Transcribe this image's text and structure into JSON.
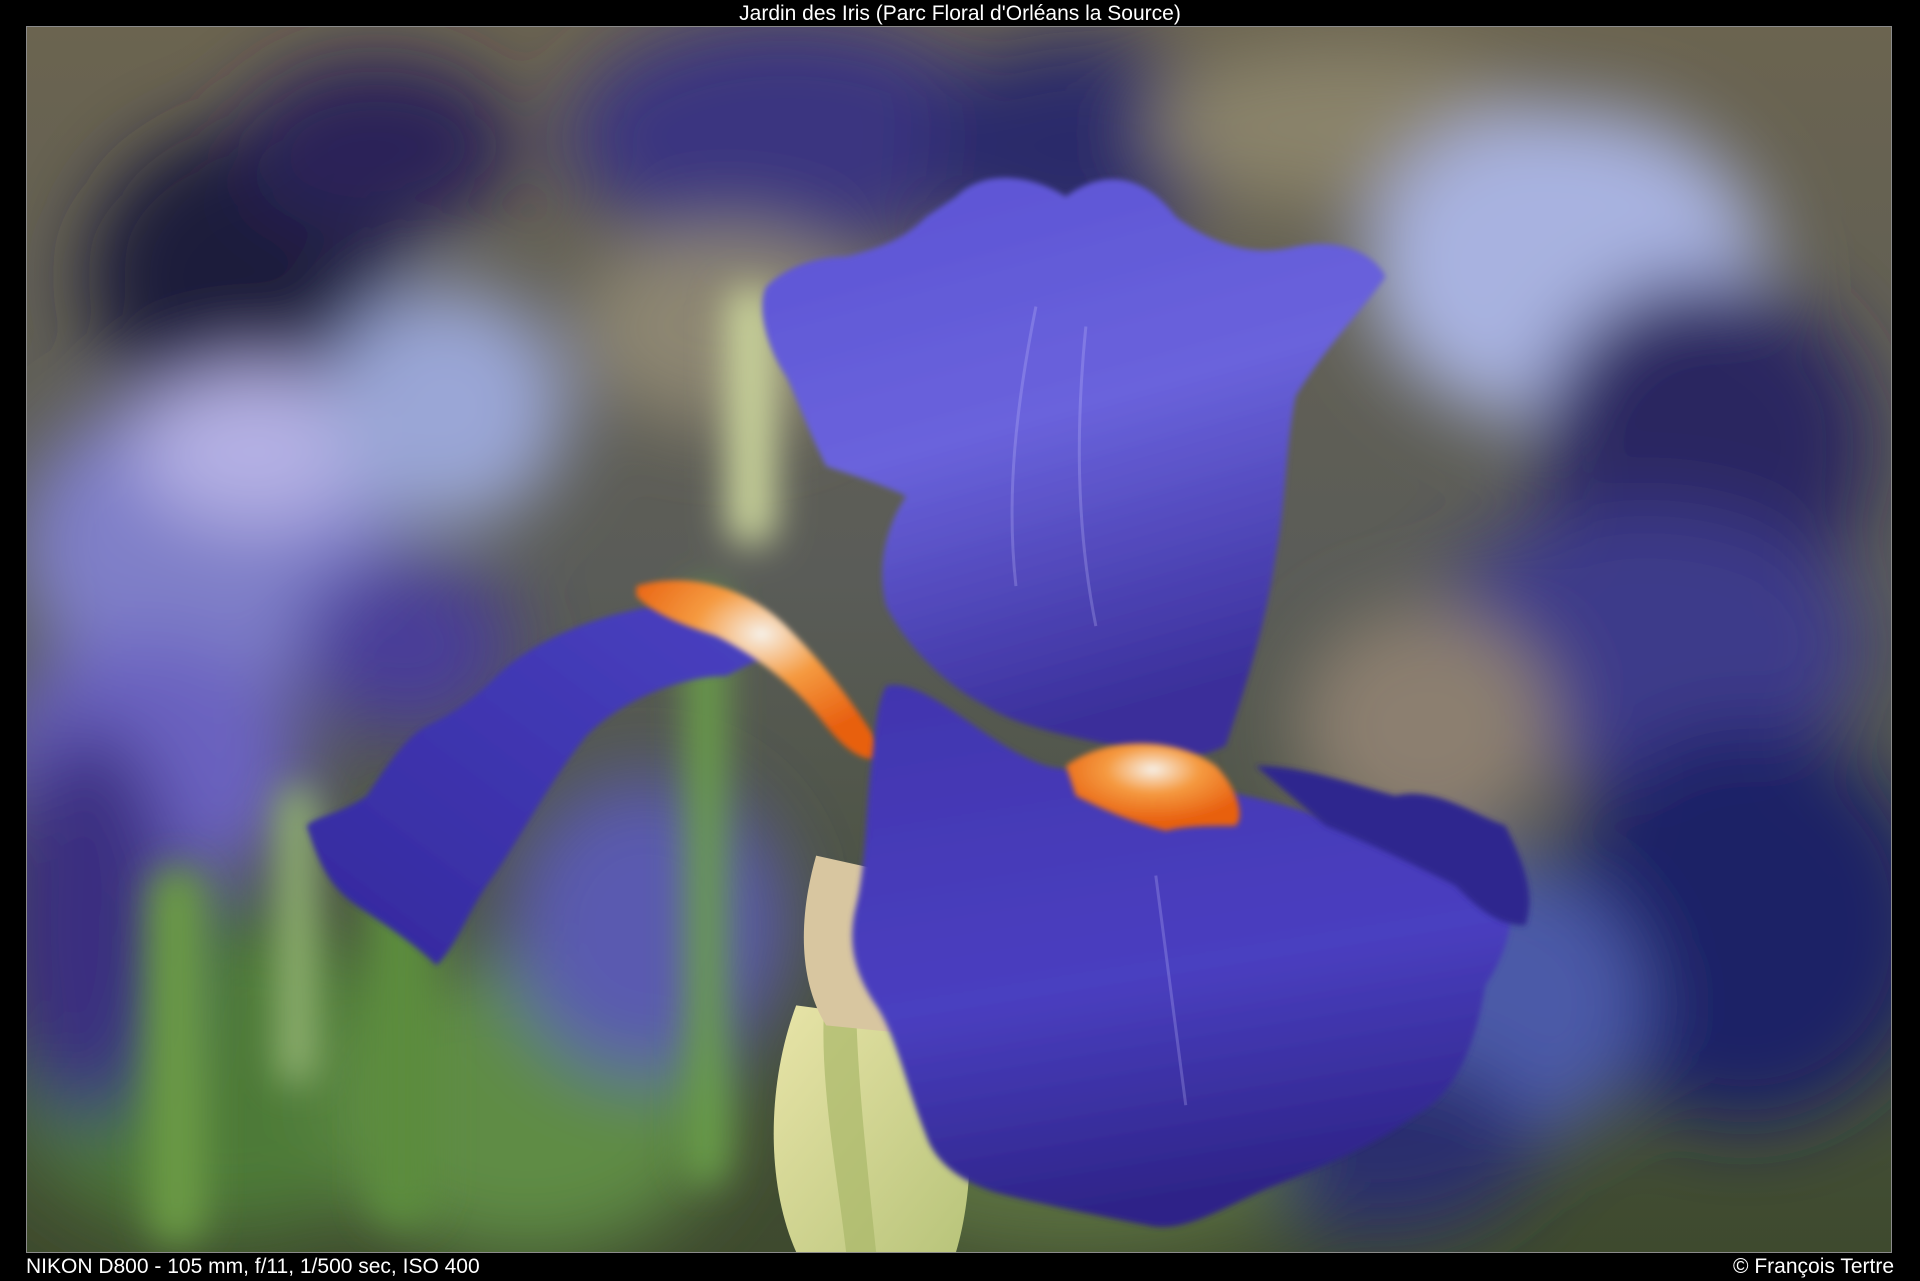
{
  "photo": {
    "title": "Jardin des Iris (Parc Floral d'Orléans la Source)",
    "exif": "NIKON D800 - 105 mm, f/11, 1/500 sec, ISO 400",
    "copyright": "© François Tertre",
    "subject": "blue bearded iris",
    "colors": {
      "background": "#000000",
      "frame_border": "#8a8a8a",
      "petal_blue": "#4a3fb8",
      "petal_light": "#7a72e0",
      "beard_orange": "#f07020",
      "stem_green": "#6a9a48"
    }
  }
}
